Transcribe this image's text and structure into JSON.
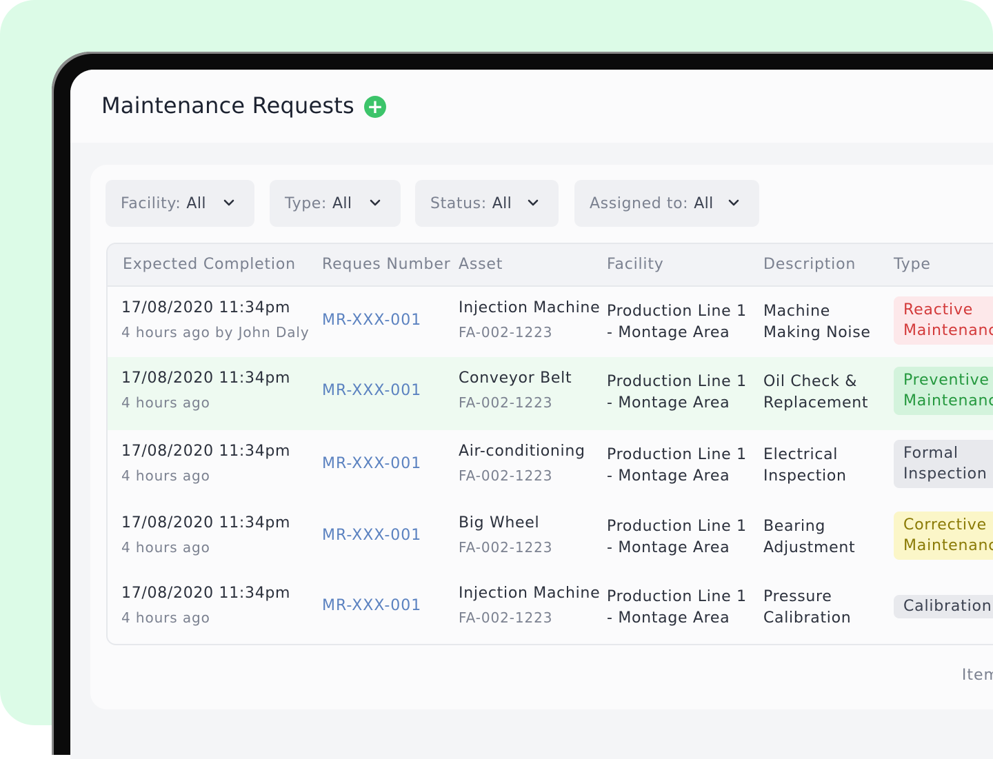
{
  "header": {
    "title": "Maintenance Requests",
    "add_icon": "plus-circle-icon"
  },
  "filters": [
    {
      "label": "Facility:",
      "value": "All"
    },
    {
      "label": "Type:",
      "value": "All"
    },
    {
      "label": "Status:",
      "value": "All"
    },
    {
      "label": "Assigned to:",
      "value": "All"
    }
  ],
  "table": {
    "columns": [
      "Expected Completion",
      "Reques Number",
      "Asset",
      "Facility",
      "Description",
      "Type"
    ],
    "rows": [
      {
        "completion": "17/08/2020 11:34pm",
        "completion_sub": "4 hours ago by John Daly",
        "number": "MR-XXX-001",
        "asset": "Injection Machine",
        "asset_code": "FA-002-1223",
        "facility_1": "Production Line 1",
        "facility_2": "- Montage Area",
        "description_1": "Machine",
        "description_2": "Making Noise",
        "type_1": "Reactive",
        "type_2": "Maintenance",
        "type_bg": "#fde8ea",
        "type_color": "#d33a3a"
      },
      {
        "completion": "17/08/2020 11:34pm",
        "completion_sub": "4 hours ago",
        "number": "MR-XXX-001",
        "asset": "Conveyor Belt",
        "asset_code": "FA-002-1223",
        "facility_1": "Production Line 1",
        "facility_2": "- Montage Area",
        "description_1": "Oil Check &",
        "description_2": "Replacement",
        "type_1": "Preventive",
        "type_2": "Maintenance",
        "type_bg": "#d3f3dc",
        "type_color": "#24983e"
      },
      {
        "completion": "17/08/2020 11:34pm",
        "completion_sub": "4 hours ago",
        "number": "MR-XXX-001",
        "asset": "Air-conditioning",
        "asset_code": "FA-002-1223",
        "facility_1": "Production Line 1",
        "facility_2": "- Montage Area",
        "description_1": "Electrical",
        "description_2": "Inspection",
        "type_1": "Formal",
        "type_2": "Inspection",
        "type_bg": "#e8e9ed",
        "type_color": "#3b4150"
      },
      {
        "completion": "17/08/2020 11:34pm",
        "completion_sub": "4 hours ago",
        "number": "MR-XXX-001",
        "asset": "Big Wheel",
        "asset_code": "FA-002-1223",
        "facility_1": "Production Line 1",
        "facility_2": "- Montage Area",
        "description_1": "Bearing",
        "description_2": "Adjustment",
        "type_1": "Corrective",
        "type_2": "Maintenance",
        "type_bg": "#fbf6c8",
        "type_color": "#8a7a06"
      },
      {
        "completion": "17/08/2020 11:34pm",
        "completion_sub": "4 hours ago",
        "number": "MR-XXX-001",
        "asset": "Injection Machine",
        "asset_code": "FA-002-1223",
        "facility_1": "Production Line 1",
        "facility_2": "- Montage Area",
        "description_1": "Pressure",
        "description_2": "Calibration",
        "type_1": "Calibration",
        "type_2": "",
        "type_bg": "#e8e9ed",
        "type_color": "#3b4150"
      }
    ]
  },
  "footer": {
    "items_per_page_label": "Items per"
  }
}
